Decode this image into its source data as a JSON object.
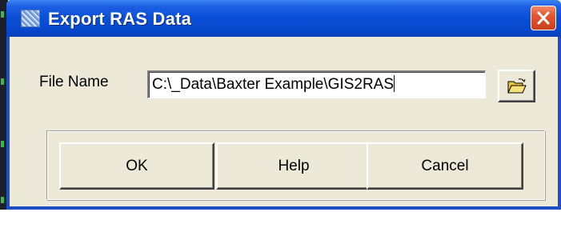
{
  "window": {
    "title": "Export RAS Data",
    "app_icon": "ras-export-icon",
    "close_icon": "close-icon"
  },
  "form": {
    "file_name_label": "File Name",
    "file_path_value": "C:\\_Data\\Baxter Example\\GIS2RAS",
    "browse_icon": "open-folder-icon"
  },
  "buttons": {
    "ok_label": "OK",
    "help_label": "Help",
    "cancel_label": "Cancel"
  },
  "colors": {
    "titlebar": "#0a4fd8",
    "dialog_face": "#ece9d8",
    "close_button": "#e0562f"
  }
}
